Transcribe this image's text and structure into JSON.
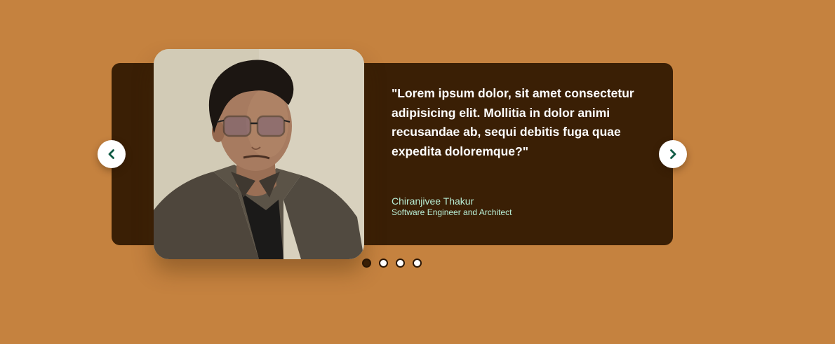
{
  "testimonial": {
    "quote": "\"Lorem ipsum dolor, sit amet consectetur adipisicing elit. Mollitia in dolor animi recusandae ab, sequi debitis fuga quae expedita doloremque?\"",
    "author_name": "Chiranjivee Thakur",
    "author_role": "Software Engineer and Architect"
  },
  "navigation": {
    "prev_icon": "chevron-left-icon",
    "next_icon": "chevron-right-icon"
  },
  "pagination": {
    "count": 4,
    "active_index": 0
  },
  "colors": {
    "background": "#c5823f",
    "card": "#3a1f05",
    "author_text": "#b8eed5",
    "chevron": "#0f5a44"
  }
}
